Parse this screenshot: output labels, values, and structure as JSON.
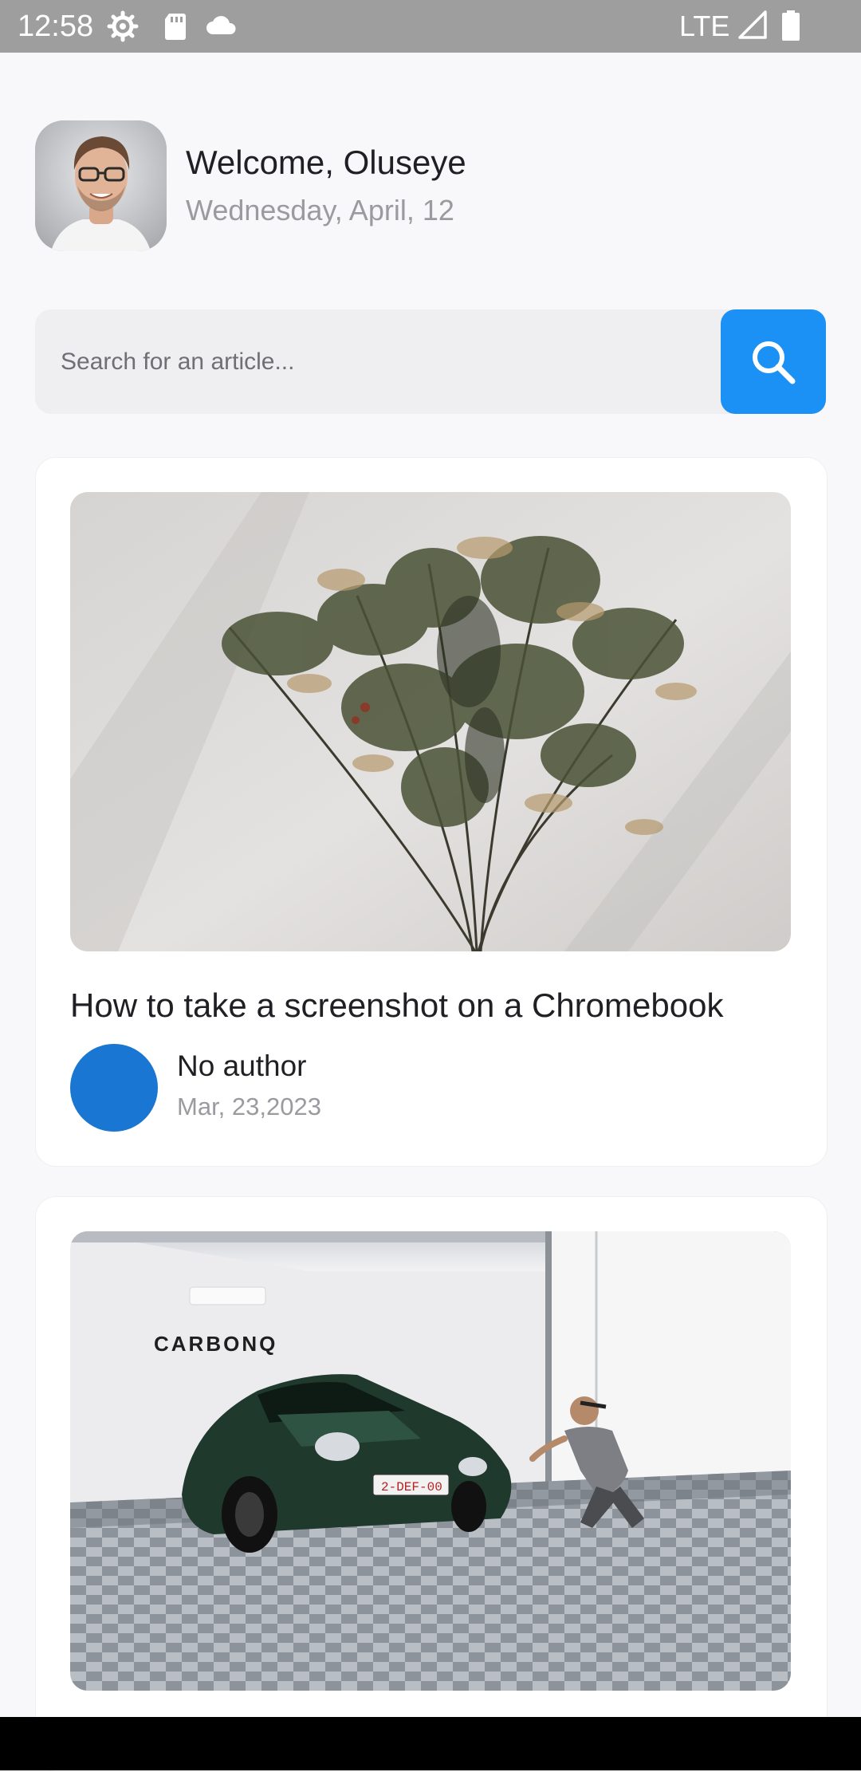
{
  "status_bar": {
    "time": "12:58",
    "network": "LTE",
    "icons": [
      "settings-icon",
      "sd-card-icon",
      "cloud-icon",
      "signal-icon",
      "battery-icon"
    ]
  },
  "header": {
    "welcome": "Welcome, Oluseye",
    "date": "Wednesday, April, 12",
    "avatar_icon": "profile-photo"
  },
  "search": {
    "placeholder": "Search for an article...",
    "value": "",
    "button_icon": "search-icon",
    "button_color": "#1b90f5"
  },
  "articles": [
    {
      "image": "dried-grass-plant-photo",
      "title": "How to take a screenshot on a Chromebook",
      "author": "No author",
      "date": "Mar, 23,2023",
      "author_avatar_color": "#1976d2"
    },
    {
      "image": "green-sports-car-garage-photo",
      "plate_text": "2-DEF-00",
      "brand_text": "CARBONQ"
    }
  ],
  "colors": {
    "accent": "#1b90f5",
    "status_bar": "#9e9e9e",
    "background": "#f8f8fa"
  }
}
